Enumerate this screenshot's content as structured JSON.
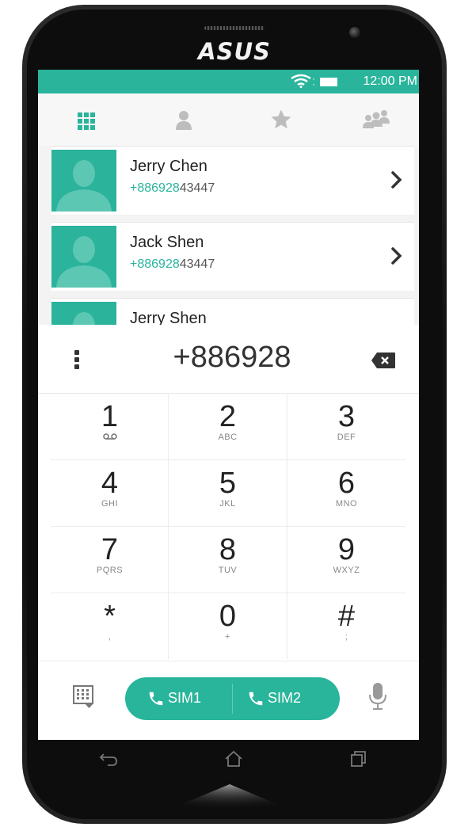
{
  "device": {
    "brand": "ASUS"
  },
  "status_bar": {
    "time": "12:00 PM"
  },
  "tabs": [
    {
      "name": "dialer",
      "icon": "dialpad-grid-icon",
      "active": true
    },
    {
      "name": "contacts",
      "icon": "person-icon"
    },
    {
      "name": "favorites",
      "icon": "star-icon"
    },
    {
      "name": "groups",
      "icon": "group-icon"
    }
  ],
  "contacts": [
    {
      "name": "Jerry Chen",
      "number_match": "886928",
      "number_rest": "43447",
      "number_prefix": "+"
    },
    {
      "name": "Jack Shen",
      "number_match": "886928",
      "number_rest": "43447",
      "number_prefix": "+"
    },
    {
      "name": "Jerry Shen"
    }
  ],
  "dialer": {
    "number": "+886928",
    "keys": [
      {
        "digit": "1",
        "letters": ""
      },
      {
        "digit": "2",
        "letters": "ABC"
      },
      {
        "digit": "3",
        "letters": "DEF"
      },
      {
        "digit": "4",
        "letters": "GHI"
      },
      {
        "digit": "5",
        "letters": "JKL"
      },
      {
        "digit": "6",
        "letters": "MNO"
      },
      {
        "digit": "7",
        "letters": "PQRS"
      },
      {
        "digit": "8",
        "letters": "TUV"
      },
      {
        "digit": "9",
        "letters": "WXYZ"
      },
      {
        "digit": "*",
        "letters": ","
      },
      {
        "digit": "0",
        "letters": "+"
      },
      {
        "digit": "#",
        "letters": ";"
      }
    ],
    "sim1_label": "SIM1",
    "sim2_label": "SIM2"
  },
  "colors": {
    "accent": "#2ab49c"
  }
}
